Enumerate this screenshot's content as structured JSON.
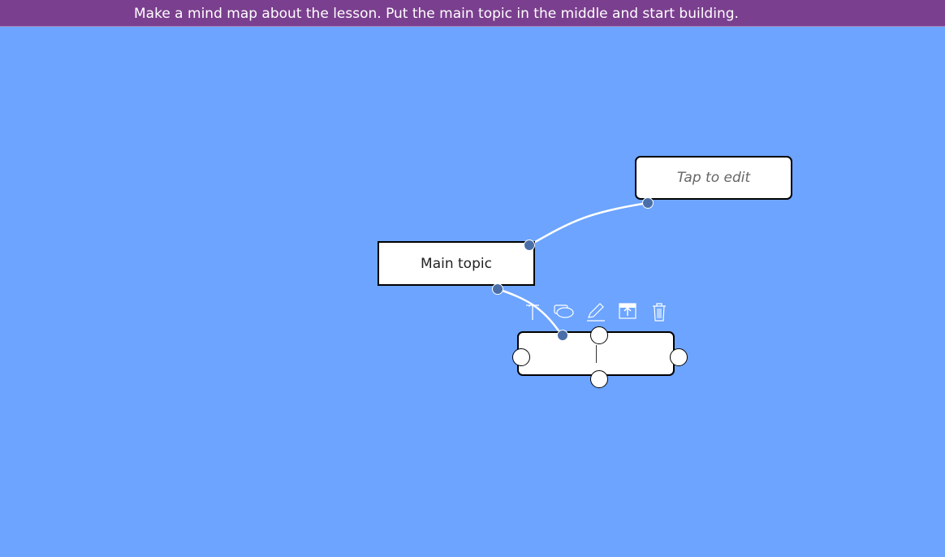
{
  "banner": {
    "instruction": "Make a mind map about the lesson. Put the main topic in the middle and start building."
  },
  "mindmap": {
    "nodes": {
      "main": {
        "label": "Main topic"
      },
      "child": {
        "label": "Tap to edit"
      },
      "new": {
        "label": ""
      }
    },
    "toolbar": {
      "items": [
        "text-icon",
        "shape-icon",
        "pencil-icon",
        "fill-icon",
        "trash-icon"
      ]
    }
  },
  "colors": {
    "background": "#6ca4ff",
    "banner": "#7b3f8f",
    "anchor": "#4a6fa8",
    "link": "#ffffff"
  }
}
